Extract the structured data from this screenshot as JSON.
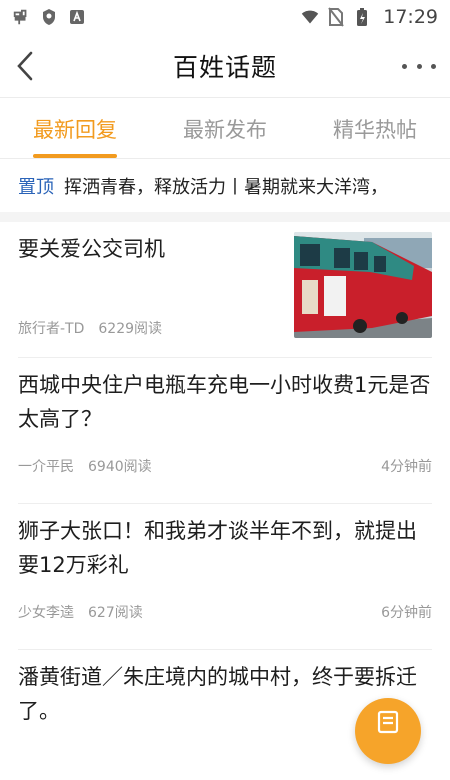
{
  "status_bar": {
    "time": "17:29",
    "left_icons": [
      "app-logo-icon",
      "shield-icon",
      "a-badge-icon"
    ],
    "right_icons": [
      "wifi-icon",
      "no-sim-icon",
      "battery-charging-icon"
    ]
  },
  "header": {
    "title": "百姓话题"
  },
  "tabs": [
    {
      "label": "最新回复",
      "active": true
    },
    {
      "label": "最新发布",
      "active": false
    },
    {
      "label": "精华热帖",
      "active": false
    }
  ],
  "pinned": {
    "tag": "置顶",
    "text": "挥洒青春，释放活力丨暑期就来大洋湾，"
  },
  "posts": [
    {
      "title": "要关爱公交司机",
      "author": "旅行者-TD",
      "reads": "6229阅读",
      "time": "",
      "has_image": true
    },
    {
      "title": "西城中央住户电瓶车充电一小时收费1元是否太高了？",
      "author": "一介平民",
      "reads": "6940阅读",
      "time": "4分钟前"
    },
    {
      "title": "狮子大张口！和我弟才谈半年不到，就提出要12万彩礼",
      "author": "少女李逵",
      "reads": "627阅读",
      "time": "6分钟前"
    },
    {
      "title": "潘黄街道／朱庄境内的城中村，终于要拆迁了。",
      "author": "",
      "reads": "",
      "time": ""
    }
  ],
  "colors": {
    "accent": "#f29b1f",
    "pinned_tag": "#2a63b8",
    "fab": "#f6a42a"
  }
}
